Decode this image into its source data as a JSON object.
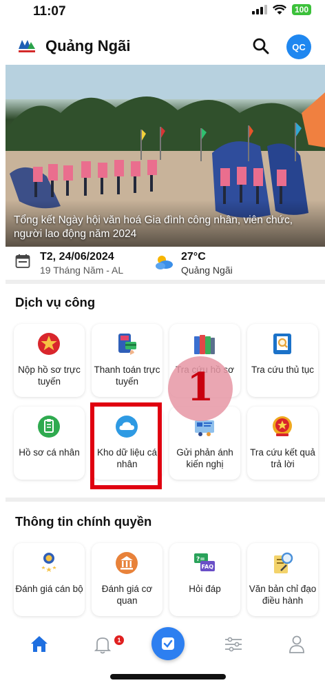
{
  "status_bar": {
    "time": "11:07",
    "battery": "100"
  },
  "header": {
    "title": "Quảng Ngãi",
    "avatar_initials": "QC",
    "search_icon": "search-icon"
  },
  "banner": {
    "caption": "Tổng kết Ngày hội văn hoá Gia đình công nhân, viên chức, người lao động năm 2024"
  },
  "info": {
    "date": "T2, 24/06/2024",
    "lunar_date": "19 Tháng Năm - AL",
    "temperature": "27°C",
    "location": "Quảng Ngãi"
  },
  "public_services": {
    "title": "Dịch vụ công",
    "items": [
      {
        "label": "Nộp hồ sơ trực tuyến",
        "icon": "star-emblem-icon"
      },
      {
        "label": "Thanh toán trực tuyến",
        "icon": "payment-icon"
      },
      {
        "label": "Tra cứu hồ sơ",
        "icon": "folders-icon"
      },
      {
        "label": "Tra cứu thủ tục",
        "icon": "document-search-icon"
      },
      {
        "label": "Hồ sơ cá nhân",
        "icon": "clipboard-icon"
      },
      {
        "label": "Kho dữ liệu cá nhân",
        "icon": "cloud-icon"
      },
      {
        "label": "Gửi phản ánh kiến nghị",
        "icon": "feedback-icon"
      },
      {
        "label": "Tra cứu kết quả trả lời",
        "icon": "national-emblem-icon"
      }
    ]
  },
  "government_info": {
    "title": "Thông tin chính quyền",
    "items": [
      {
        "label": "Đánh giá cán bộ",
        "icon": "officer-rating-icon"
      },
      {
        "label": "Đánh giá cơ quan",
        "icon": "agency-icon"
      },
      {
        "label": "Hỏi đáp",
        "icon": "faq-icon"
      },
      {
        "label": "Văn bản chỉ đạo điều hành",
        "icon": "directive-document-icon"
      }
    ]
  },
  "bottom_nav": {
    "notification_count": "1",
    "items": [
      "home-icon",
      "bell-icon",
      "check-icon",
      "sliders-icon",
      "user-icon"
    ]
  },
  "annotation": {
    "step_number": "1"
  },
  "colors": {
    "accent": "#2d7ff0",
    "highlight": "#e00010",
    "badge": "#e02020"
  }
}
